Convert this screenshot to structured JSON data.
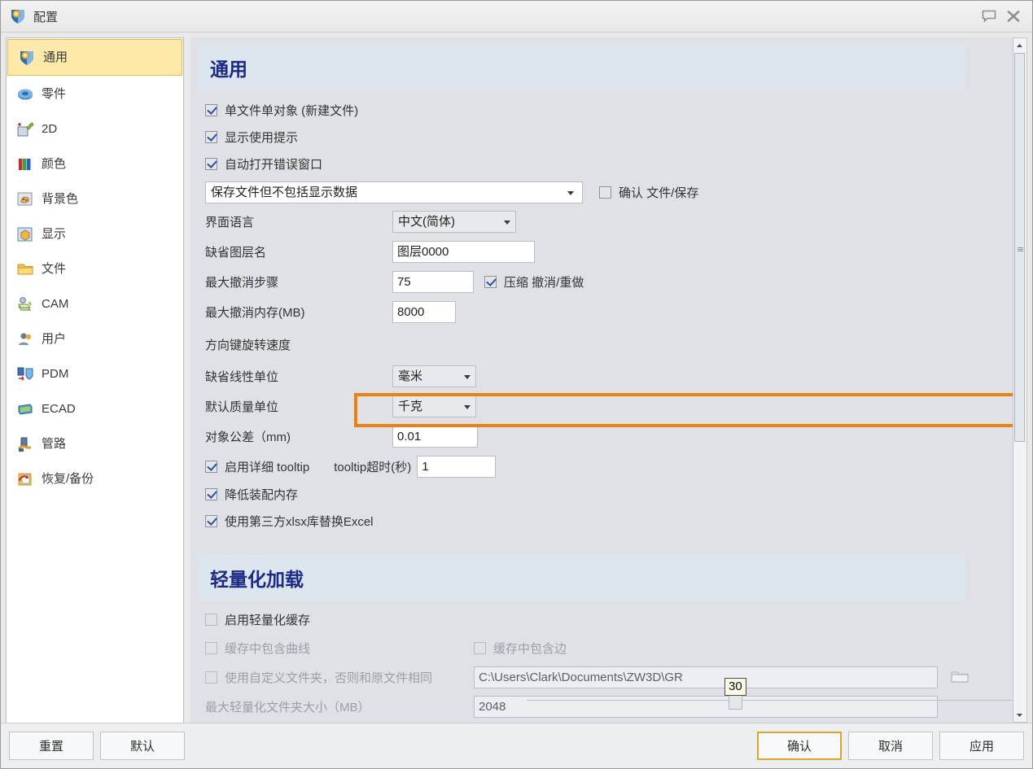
{
  "window": {
    "title": "配置",
    "icon": "app-shield-icon",
    "help_icon": "comment-icon",
    "close_icon": "close-icon"
  },
  "sidebar": {
    "items": [
      {
        "label": "通用",
        "icon": "shield-gear-icon",
        "selected": true
      },
      {
        "label": "零件",
        "icon": "part-icon",
        "selected": false
      },
      {
        "label": "2D",
        "icon": "sketch-icon",
        "selected": false
      },
      {
        "label": "颜色",
        "icon": "color-bars-icon",
        "selected": false
      },
      {
        "label": "背景色",
        "icon": "palette-icon",
        "selected": false
      },
      {
        "label": "显示",
        "icon": "display-box-icon",
        "selected": false
      },
      {
        "label": "文件",
        "icon": "folder-icon",
        "selected": false
      },
      {
        "label": "CAM",
        "icon": "cam-icon",
        "selected": false
      },
      {
        "label": "用户",
        "icon": "user-icon",
        "selected": false
      },
      {
        "label": "PDM",
        "icon": "pdm-icon",
        "selected": false
      },
      {
        "label": "ECAD",
        "icon": "ecad-icon",
        "selected": false
      },
      {
        "label": "管路",
        "icon": "pipe-icon",
        "selected": false
      },
      {
        "label": "恢复/备份",
        "icon": "backup-icon",
        "selected": false
      }
    ]
  },
  "general": {
    "heading": "通用",
    "cb_single_file": "单文件单对象 (新建文件)",
    "cb_show_tips": "显示使用提示",
    "cb_auto_open_error": "自动打开错误窗口",
    "save_mode_value": "保存文件但不包括显示数据",
    "cb_confirm_save": "确认 文件/保存",
    "lbl_language": "界面语言",
    "language_value": "中文(简体)",
    "lbl_default_layer": "缺省图层名",
    "default_layer_value": "图层0000",
    "lbl_max_undo_steps": "最大撤消步骤",
    "max_undo_steps_value": "75",
    "cb_compress_undo": "压缩 撤消/重做",
    "lbl_max_undo_mem": "最大撤消内存(MB)",
    "max_undo_mem_value": "8000",
    "lbl_arrow_rotate_speed": "方向键旋转速度",
    "arrow_rotate_speed_value": "30",
    "lbl_linear_unit": "缺省线性单位",
    "linear_unit_value": "毫米",
    "lbl_mass_unit": "默认质量单位",
    "mass_unit_value": "千克",
    "lbl_object_tolerance": "对象公差（mm)",
    "object_tolerance_value": "0.01",
    "cb_enable_tooltip": "启用详细 tooltip",
    "lbl_tooltip_timeout": "tooltip超时(秒)",
    "tooltip_timeout_value": "1",
    "cb_reduce_assembly_mem": "降低装配内存",
    "cb_third_party_xlsx": "使用第三方xlsx库替换Excel"
  },
  "lightweight": {
    "heading": "轻量化加载",
    "cb_enable_cache": "启用轻量化缓存",
    "cb_cache_curves": "缓存中包含曲线",
    "cb_cache_edges": "缓存中包含边",
    "cb_custom_folder": "使用自定义文件夹，否则和原文件相同",
    "custom_folder_value": "C:\\Users\\Clark\\Documents\\ZW3D\\GR",
    "browse_icon": "folder-browse-icon",
    "lbl_max_folder_size": "最大轻量化文件夹大小（MB）",
    "max_folder_size_value": "2048"
  },
  "footer": {
    "reset": "重置",
    "default": "默认",
    "ok": "确认",
    "cancel": "取消",
    "apply": "应用"
  },
  "scrollbar": {
    "up_icon": "scroll-up-icon",
    "down_icon": "scroll-down-icon"
  },
  "colors": {
    "highlight": "#ef7f12",
    "selected_item": "#ffe9a6",
    "heading_text": "#1a2a86",
    "section_bg": "#dde5ee",
    "primary_button_border": "#d9a82b"
  }
}
